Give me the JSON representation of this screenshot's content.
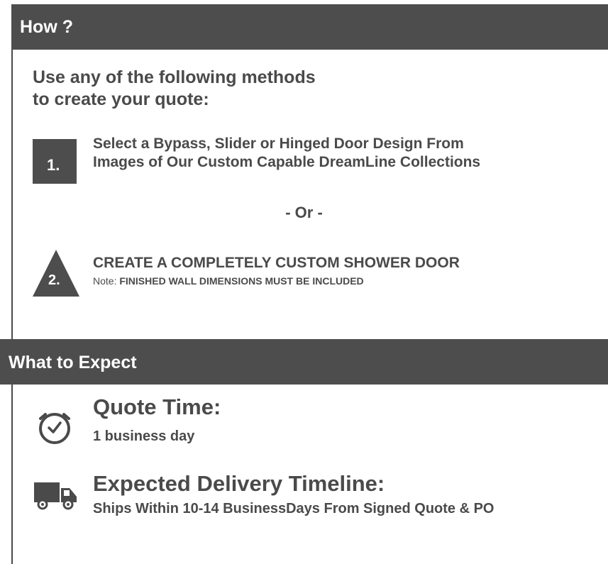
{
  "how": {
    "header": "How ?",
    "intro_line1": "Use any of the following methods",
    "intro_line2": "to create your quote:",
    "step1": {
      "number": "1.",
      "line1": "Select a Bypass, Slider or Hinged Door Design From",
      "line2": "Images of Our Custom Capable DreamLine Collections"
    },
    "or_text": "- Or -",
    "step2": {
      "number": "2.",
      "title": "CREATE A COMPLETELY CUSTOM SHOWER DOOR",
      "note_label": "Note: ",
      "note_text": "FINISHED WALL DIMENSIONS MUST BE INCLUDED"
    }
  },
  "expect": {
    "header": "What to Expect",
    "quote_time": {
      "icon": "clock-icon",
      "title": "Quote Time:",
      "value": "1 business day"
    },
    "delivery": {
      "icon": "truck-icon",
      "title": "Expected Delivery Timeline:",
      "value": "Ships Within 10-14 BusinessDays From Signed Quote & PO"
    }
  },
  "colors": {
    "header_bg": "#4d4d4d",
    "text": "#4a4a4a",
    "background": "#ffffff"
  }
}
